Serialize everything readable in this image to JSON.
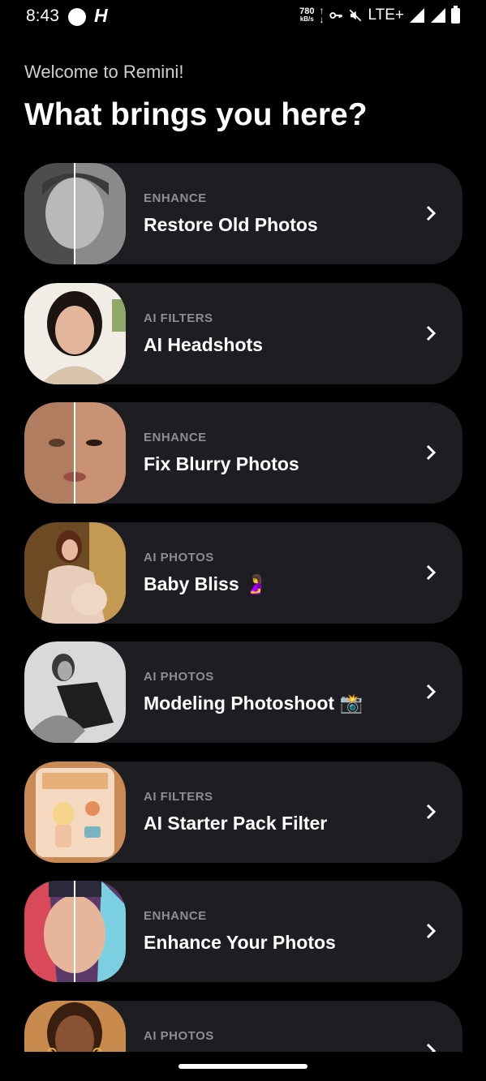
{
  "status_bar": {
    "time": "8:43",
    "net_speed": "780",
    "net_unit": "kB/s",
    "network": "LTE+"
  },
  "header": {
    "welcome": "Welcome to Remini!",
    "title": "What brings you here?"
  },
  "cards": [
    {
      "category": "ENHANCE",
      "title": "Restore Old Photos",
      "thumb_icon": "old-portrait-thumbnail"
    },
    {
      "category": "AI FILTERS",
      "title": "AI Headshots",
      "thumb_icon": "headshot-thumbnail"
    },
    {
      "category": "ENHANCE",
      "title": "Fix Blurry Photos",
      "thumb_icon": "blurry-face-thumbnail"
    },
    {
      "category": "AI PHOTOS",
      "title": "Baby Bliss 🤰",
      "thumb_icon": "maternity-thumbnail"
    },
    {
      "category": "AI PHOTOS",
      "title": "Modeling Photoshoot 📸",
      "thumb_icon": "bw-model-thumbnail"
    },
    {
      "category": "AI FILTERS",
      "title": "AI Starter Pack Filter",
      "thumb_icon": "starter-pack-thumbnail"
    },
    {
      "category": "ENHANCE",
      "title": "Enhance Your Photos",
      "thumb_icon": "enhance-face-thumbnail"
    },
    {
      "category": "AI PHOTOS",
      "title": "",
      "thumb_icon": "portrait-thumbnail"
    }
  ],
  "colors": {
    "background": "#000000",
    "card": "#1e1e22",
    "category_text": "#8d8d92"
  }
}
